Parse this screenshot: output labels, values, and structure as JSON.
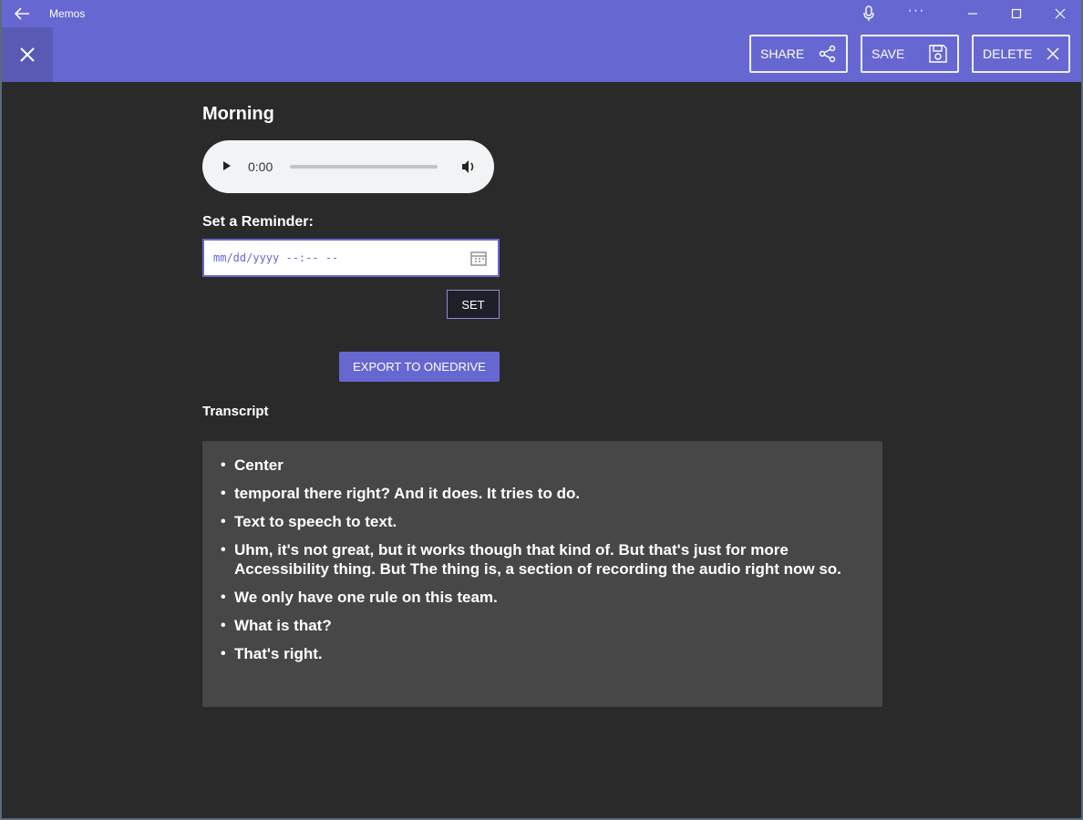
{
  "window": {
    "app_title": "Memos",
    "icons": {
      "back": "arrow-left-icon",
      "mic": "microphone-icon",
      "more": "more-icon",
      "minimize": "minimize-icon",
      "maximize": "maximize-icon",
      "close": "close-icon"
    },
    "more_glyph": "···"
  },
  "toolbar": {
    "share_label": "SHARE",
    "save_label": "SAVE",
    "delete_label": "DELETE",
    "accent_color": "#6767d1"
  },
  "memo": {
    "title": "Morning",
    "audio": {
      "time": "0:00",
      "progress": 0
    }
  },
  "reminder": {
    "label": "Set a Reminder:",
    "placeholder": "mm/dd/yyyy --:-- --",
    "set_label": "SET"
  },
  "export": {
    "label": "EXPORT TO ONEDRIVE"
  },
  "transcript": {
    "label": "Transcript",
    "items": [
      "Center",
      "temporal there right? And it does. It tries to do.",
      "Text to speech to text.",
      "Uhm, it's not great, but it works though that kind of. But that's just for more Accessibility thing. But The thing is, a section of recording the audio right now so.",
      "We only have one rule on this team.",
      "What is that?",
      "That's right."
    ]
  }
}
